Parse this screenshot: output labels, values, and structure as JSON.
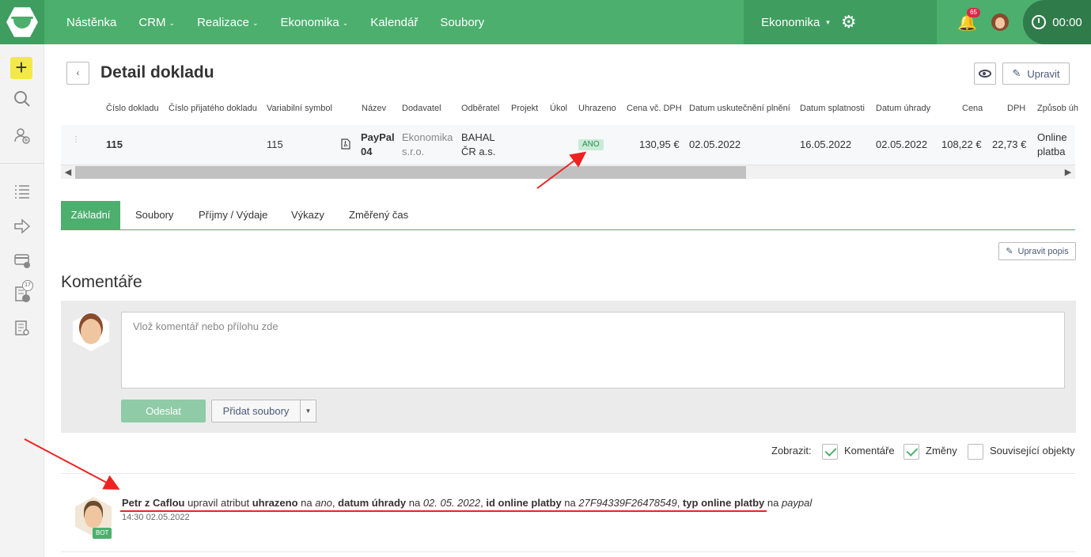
{
  "nav": {
    "items": [
      {
        "label": "Nástěnka",
        "dropdown": false
      },
      {
        "label": "CRM",
        "dropdown": true
      },
      {
        "label": "Realizace",
        "dropdown": true
      },
      {
        "label": "Ekonomika",
        "dropdown": true
      },
      {
        "label": "Kalendář",
        "dropdown": false
      },
      {
        "label": "Soubory",
        "dropdown": false
      }
    ],
    "module": "Ekonomika",
    "notifications": "65",
    "timer": "00:00"
  },
  "sidebar": {
    "badge": "17"
  },
  "page": {
    "title": "Detail dokladu",
    "edit_label": "Upravit"
  },
  "table": {
    "columns": [
      "Číslo dokladu",
      "Číslo přijatého dokladu",
      "Variabilní symbol",
      "Název",
      "Dodavatel",
      "Odběratel",
      "Projekt",
      "Úkol",
      "Uhrazeno",
      "Cena vč. DPH",
      "Datum uskutečnění plnění",
      "Datum splatnosti",
      "Datum úhrady",
      "Cena",
      "DPH",
      "Způsob úh"
    ],
    "row": {
      "cislo": "115",
      "vs": "115",
      "nazev_1": "PayPal",
      "nazev_2": "04",
      "dodavatel_1": "Ekonomika",
      "dodavatel_2": "s.r.o.",
      "odberatel_1": "BAHAL",
      "odberatel_2": "ČR a.s.",
      "uhrazeno": "ANO",
      "cena_dph": "130,95 €",
      "duzp": "02.05.2022",
      "splatnost": "16.05.2022",
      "uhrada": "02.05.2022",
      "cena": "108,22 €",
      "dph": "22,73 €",
      "zpusob_1": "Online",
      "zpusob_2": "platba"
    }
  },
  "tabs": [
    "Základní",
    "Soubory",
    "Příjmy / Výdaje",
    "Výkazy",
    "Změřený čas"
  ],
  "edit_desc_label": "Upravit popis",
  "comments": {
    "title": "Komentáře",
    "placeholder": "Vlož komentář nebo přílohu zde",
    "send_label": "Odeslat",
    "add_files_label": "Přidat soubory"
  },
  "filter": {
    "label": "Zobrazit:",
    "options": [
      {
        "label": "Komentáře",
        "checked": true
      },
      {
        "label": "Změny",
        "checked": true
      },
      {
        "label": "Související objekty",
        "checked": false
      }
    ]
  },
  "log": {
    "author": "Petr z Caflou",
    "t1": " upravil atribut ",
    "attr1": "uhrazeno",
    "na": " na ",
    "val1": "ano",
    "attr2": "datum úhrady",
    "val2": "02. 05. 2022",
    "attr3": "id online platby",
    "val3": "27F94339F26478549",
    "attr4": "typ online platby",
    "val4": "paypal",
    "comma": ", ",
    "time": "14:30 02.05.2022",
    "badge": "BOT"
  },
  "colors": {
    "brand": "#4caf6e",
    "annotation": "#e22222"
  }
}
